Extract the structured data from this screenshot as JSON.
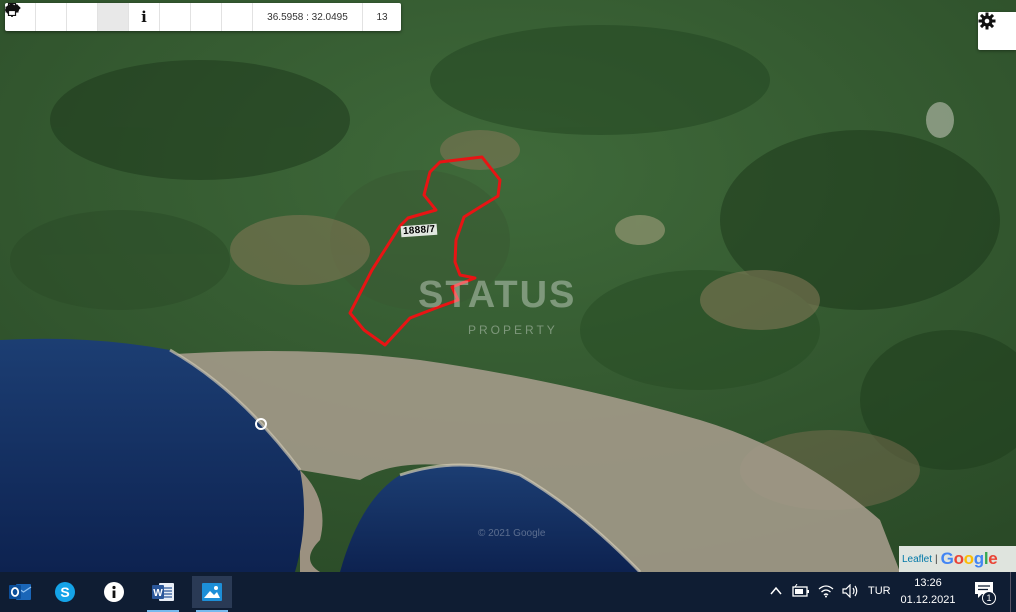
{
  "toolbar": {
    "zoom_in_icon": "plus-icon",
    "zoom_out_icon": "minus-icon",
    "refresh_icon": "refresh-icon",
    "locate_icon": "crosshair-icon",
    "info_label": "i",
    "favorite_icon": "star-icon",
    "measure_icon": "arrows-horizontal-icon",
    "print_icon": "printer-icon",
    "coordinates": "36.5958 : 32.0495",
    "zoom_level": "13"
  },
  "map": {
    "parcel_label": "1888/7",
    "parcel_outline_color": "#e81414",
    "watermark_title": "STATUS",
    "watermark_subtitle": "PROPERTY",
    "imagery_copyright": "© 2021 Google",
    "attribution_leaflet": "Leaflet",
    "attribution_separator": "|",
    "attribution_google": "Google"
  },
  "taskbar": {
    "apps": [
      {
        "name": "outlook",
        "icon": "outlook-icon"
      },
      {
        "name": "skype",
        "icon": "skype-icon"
      },
      {
        "name": "info",
        "icon": "info-icon"
      },
      {
        "name": "word",
        "icon": "word-icon"
      },
      {
        "name": "photos",
        "icon": "photos-icon"
      }
    ],
    "language": "TUR",
    "time": "13:26",
    "date": "01.12.2021",
    "notification_count": "1"
  }
}
